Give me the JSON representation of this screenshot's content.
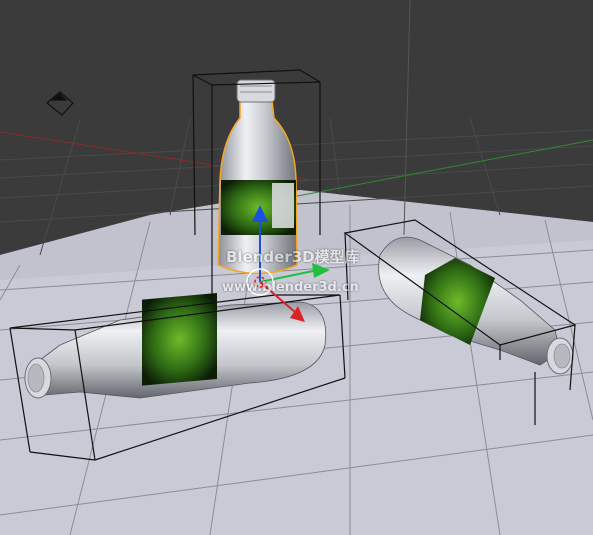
{
  "viewport": {
    "background": "#3b3b3b",
    "floor_color": "#c9cad6",
    "grid_color": "#8b8c98",
    "selection_color": "#f5a623"
  },
  "objects": [
    {
      "name": "bottle",
      "selected": true,
      "orientation": "upright"
    },
    {
      "name": "bottle",
      "selected": false,
      "orientation": "lying"
    },
    {
      "name": "bottle",
      "selected": false,
      "orientation": "lying"
    }
  ],
  "gizmo": {
    "x_axis_color": "#e0202a",
    "y_axis_color": "#20c040",
    "z_axis_color": "#1a4fe0"
  },
  "watermark": {
    "title": "Blender3D模型库",
    "url": "www.blender3d.cn"
  }
}
